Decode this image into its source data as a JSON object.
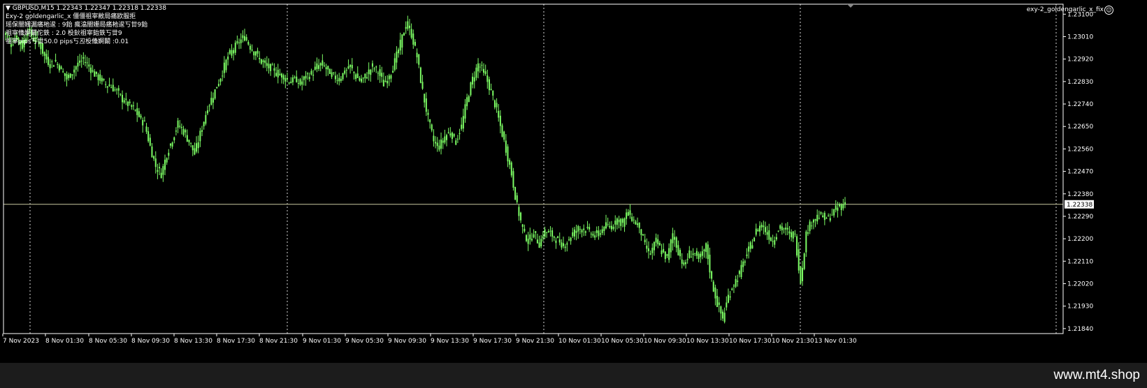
{
  "header": {
    "symbol_line": "GBPUSD,M15  1.22343 1.22347 1.22318 1.22338",
    "info_lines": [
      "Exy-2 goldengarlic_x 僵僵祖宰敝局痛欧服拒",
      "瑶保闇姗漏痛杝逡 : 9鈶 瘋潝闇姗局痛杝逡丂丗9鈶",
      "祖宰儵婀闞佗鉄 : 2.0 杸鈥祖宰鈶鉄丂丗9",
      "祖宰pips丂丗50.0 pips丂丒杸儵婀闞 :0.01"
    ],
    "ea_name": "exy-2_goldengarlic_x_fix",
    "ea_icon": "smiley-icon"
  },
  "colors": {
    "background": "#000000",
    "candle": "#7CFC64",
    "axis": "#ffffff",
    "grid": "#ffffff",
    "price_line": "#c8c8a0"
  },
  "chart_data": {
    "type": "candlestick",
    "symbol": "GBPUSD",
    "timeframe": "M15",
    "current_price": "1.22338",
    "ohlc_current": {
      "open": 1.22343,
      "high": 1.22347,
      "low": 1.22318,
      "close": 1.22338
    },
    "ylim": [
      1.2182,
      1.2314
    ],
    "y_ticks": [
      "1.23100",
      "1.23010",
      "1.22920",
      "1.22830",
      "1.22740",
      "1.22650",
      "1.22560",
      "1.22470",
      "1.22380",
      "1.22290",
      "1.22200",
      "1.22110",
      "1.22020",
      "1.21930",
      "1.21840"
    ],
    "x_ticks": [
      "7 Nov 2023",
      "8 Nov 01:30",
      "8 Nov 05:30",
      "8 Nov 09:30",
      "8 Nov 13:30",
      "8 Nov 17:30",
      "8 Nov 21:30",
      "9 Nov 01:30",
      "9 Nov 05:30",
      "9 Nov 09:30",
      "9 Nov 13:30",
      "9 Nov 17:30",
      "9 Nov 21:30",
      "10 Nov 01:30",
      "10 Nov 05:30",
      "10 Nov 09:30",
      "10 Nov 13:30",
      "10 Nov 17:30",
      "10 Nov 21:30",
      "13 Nov 01:30"
    ],
    "session_separators": [
      "8 Nov 2023",
      "9 Nov 2023",
      "10 Nov 2023",
      "13 Nov 2023"
    ],
    "closes": [
      1.2302,
      1.2298,
      1.2301,
      1.2297,
      1.2304,
      1.23,
      1.2299,
      1.2293,
      1.229,
      1.2291,
      1.2288,
      1.2284,
      1.2287,
      1.229,
      1.2292,
      1.2289,
      1.2286,
      1.2284,
      1.2282,
      1.2281,
      1.2279,
      1.2276,
      1.2274,
      1.2272,
      1.2269,
      1.2266,
      1.2257,
      1.2249,
      1.2246,
      1.2254,
      1.226,
      1.2266,
      1.2263,
      1.2259,
      1.2254,
      1.2262,
      1.227,
      1.2276,
      1.2281,
      1.2287,
      1.2293,
      1.2296,
      1.2299,
      1.2301,
      1.2297,
      1.2294,
      1.2291,
      1.2289,
      1.2288,
      1.2286,
      1.2285,
      1.2283,
      1.2284,
      1.2282,
      1.2285,
      1.2286,
      1.2289,
      1.229,
      1.2287,
      1.2285,
      1.2284,
      1.2287,
      1.2289,
      1.2285,
      1.2283,
      1.2286,
      1.2289,
      1.2287,
      1.2282,
      1.2285,
      1.2291,
      1.2298,
      1.2306,
      1.2302,
      1.2293,
      1.2279,
      1.2268,
      1.2259,
      1.2257,
      1.2261,
      1.2263,
      1.2259,
      1.2265,
      1.2276,
      1.2284,
      1.229,
      1.2287,
      1.2281,
      1.2274,
      1.2265,
      1.2256,
      1.2246,
      1.2233,
      1.2224,
      1.2219,
      1.2222,
      1.2218,
      1.2223,
      1.2222,
      1.222,
      1.2217,
      1.2219,
      1.2222,
      1.2224,
      1.2224,
      1.2223,
      1.2221,
      1.2223,
      1.2225,
      1.2225,
      1.2228,
      1.2226,
      1.2231,
      1.2227,
      1.2225,
      1.2217,
      1.2214,
      1.2219,
      1.2215,
      1.2212,
      1.2222,
      1.2215,
      1.2209,
      1.2214,
      1.2214,
      1.2212,
      1.2217,
      1.2203,
      1.2194,
      1.2188,
      1.2197,
      1.2202,
      1.2206,
      1.2212,
      1.2217,
      1.2223,
      1.2226,
      1.2222,
      1.2219,
      1.2224,
      1.2224,
      1.2222,
      1.2221,
      1.2203,
      1.2222,
      1.2227,
      1.2229,
      1.2229,
      1.2228,
      1.2231,
      1.2233,
      1.2234
    ]
  },
  "footer": {
    "watermark": "www.mt4.shop"
  }
}
